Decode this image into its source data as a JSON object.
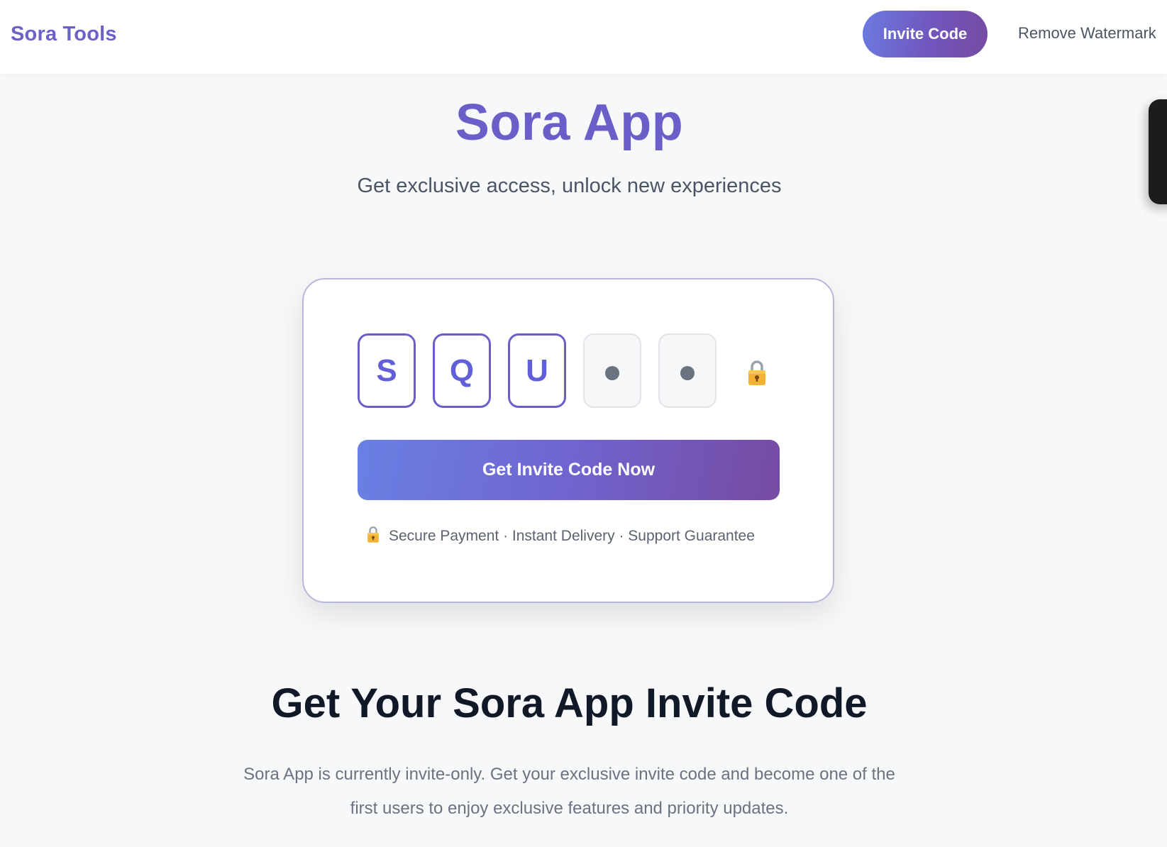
{
  "nav": {
    "brand": "Sora Tools",
    "invite_label": "Invite Code",
    "watermark_label": "Remove Watermark"
  },
  "hero": {
    "title": "Sora App",
    "subtitle": "Get exclusive access, unlock new experiences"
  },
  "card": {
    "code_chars": [
      "S",
      "Q",
      "U"
    ],
    "hidden_slots": 2,
    "cta_label": "Get Invite Code Now",
    "trust_text": "Secure Payment · Instant Delivery · Support Guarantee"
  },
  "section": {
    "title": "Get Your Sora App Invite Code",
    "body": "Sora App is currently invite-only. Get your exclusive invite code and become one of the first users to enjoy exclusive features and priority updates."
  },
  "colors": {
    "brand": "#6a5fc8",
    "gradient_start": "#6a80e4",
    "gradient_end": "#764ba2"
  },
  "icons": {
    "lock": "lock-icon"
  }
}
